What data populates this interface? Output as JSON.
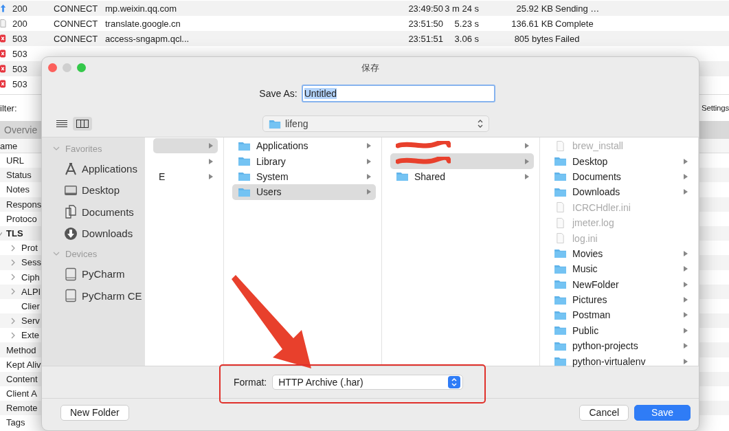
{
  "requests": [
    {
      "kind": "upload",
      "code": "200",
      "method": "CONNECT",
      "host": "mp.weixin.qq.com",
      "start": "23:49:50",
      "duration": "3 m 24 s",
      "size": "25.92 KB",
      "state": "Sending …"
    },
    {
      "kind": "document",
      "code": "200",
      "method": "CONNECT",
      "host": "translate.google.cn",
      "start": "23:51:50",
      "duration": "5.23 s",
      "size": "136.61 KB",
      "state": "Complete"
    },
    {
      "kind": "error",
      "code": "503",
      "method": "CONNECT",
      "host": "access-sngapm.qcl...",
      "start": "23:51:51",
      "duration": "3.06 s",
      "size": "805 bytes",
      "state": "Failed"
    },
    {
      "kind": "error",
      "code": "503"
    },
    {
      "kind": "error",
      "code": "503"
    },
    {
      "kind": "error",
      "code": "503"
    }
  ],
  "filter": {
    "label": "ilter:",
    "settings": "Settings"
  },
  "overview": {
    "tab": "Overvie",
    "header": "ame",
    "properties": [
      {
        "label": "URL"
      },
      {
        "label": "Status"
      },
      {
        "label": "Notes"
      },
      {
        "label": "Respons"
      },
      {
        "label": "Protoco"
      },
      {
        "label": "TLS",
        "expanded": true,
        "children": [
          {
            "label": "Prot",
            "expandable": true
          },
          {
            "label": "Sess",
            "expandable": true
          },
          {
            "label": "Ciph",
            "expandable": true
          },
          {
            "label": "ALPI",
            "expandable": true
          },
          {
            "label": "Clier",
            "expandable": false
          },
          {
            "label": "Serv",
            "expandable": true
          },
          {
            "label": "Exte",
            "expandable": true
          }
        ]
      },
      {
        "label": "Method"
      },
      {
        "label": "Kept Aliv"
      },
      {
        "label": "Content"
      },
      {
        "label": "Client A"
      },
      {
        "label": "Remote"
      },
      {
        "label": "Tags"
      }
    ]
  },
  "dialog": {
    "title": "保存",
    "save_as": {
      "label": "Save As:",
      "value": "Untitled"
    },
    "view_modes": [
      {
        "kind": "list",
        "selected": false
      },
      {
        "kind": "columns",
        "selected": true
      }
    ],
    "location": "lifeng",
    "sidebar": [
      {
        "heading": "Favorites",
        "expanded": true,
        "items": [
          {
            "kind": "applications",
            "label": "Applications"
          },
          {
            "kind": "desktop",
            "label": "Desktop"
          },
          {
            "kind": "documents",
            "label": "Documents"
          },
          {
            "kind": "downloads",
            "label": "Downloads"
          }
        ]
      },
      {
        "heading": "Devices",
        "expanded": true,
        "items": [
          {
            "kind": "disk",
            "label": "PyCharm"
          },
          {
            "kind": "disk",
            "label": "PyCharm CE"
          }
        ]
      }
    ],
    "columns": [
      [
        {
          "kind": "hidden",
          "selected": true
        },
        {
          "kind": "hidden",
          "selected": false
        },
        {
          "kind": "hidden",
          "selected": false,
          "label": "E"
        }
      ],
      [
        {
          "kind": "folder",
          "label": "Applications",
          "selected": false
        },
        {
          "kind": "folder",
          "label": "Library",
          "selected": false
        },
        {
          "kind": "folder",
          "label": "System",
          "selected": false
        },
        {
          "kind": "folder",
          "label": "Users",
          "selected": true
        }
      ],
      [
        {
          "kind": "redacted",
          "selected": false
        },
        {
          "kind": "redacted",
          "selected": true
        },
        {
          "kind": "folder",
          "label": "Shared",
          "selected": false
        }
      ],
      [
        {
          "kind": "file",
          "label": "brew_install"
        },
        {
          "kind": "folder",
          "label": "Desktop",
          "selected": false
        },
        {
          "kind": "folder",
          "label": "Documents",
          "selected": false
        },
        {
          "kind": "folder",
          "label": "Downloads",
          "selected": false
        },
        {
          "kind": "file",
          "label": "ICRCHdler.ini"
        },
        {
          "kind": "file",
          "label": "jmeter.log"
        },
        {
          "kind": "file",
          "label": "log.ini"
        },
        {
          "kind": "folder",
          "label": "Movies",
          "selected": false
        },
        {
          "kind": "folder",
          "label": "Music",
          "selected": false
        },
        {
          "kind": "folder",
          "label": "NewFolder",
          "selected": false
        },
        {
          "kind": "folder",
          "label": "Pictures",
          "selected": false
        },
        {
          "kind": "folder",
          "label": "Postman",
          "selected": false
        },
        {
          "kind": "folder",
          "label": "Public",
          "selected": false
        },
        {
          "kind": "folder",
          "label": "python-projects",
          "selected": false
        },
        {
          "kind": "folder",
          "label": "python-virtualenv",
          "selected": false
        }
      ]
    ],
    "format": {
      "label": "Format:",
      "value": "HTTP Archive (.har)"
    },
    "buttons": [
      {
        "kind": "plain",
        "label": "New Folder"
      },
      {
        "kind": "spacer"
      },
      {
        "kind": "plain",
        "label": "Cancel"
      },
      {
        "kind": "primary",
        "label": "Save"
      }
    ]
  }
}
